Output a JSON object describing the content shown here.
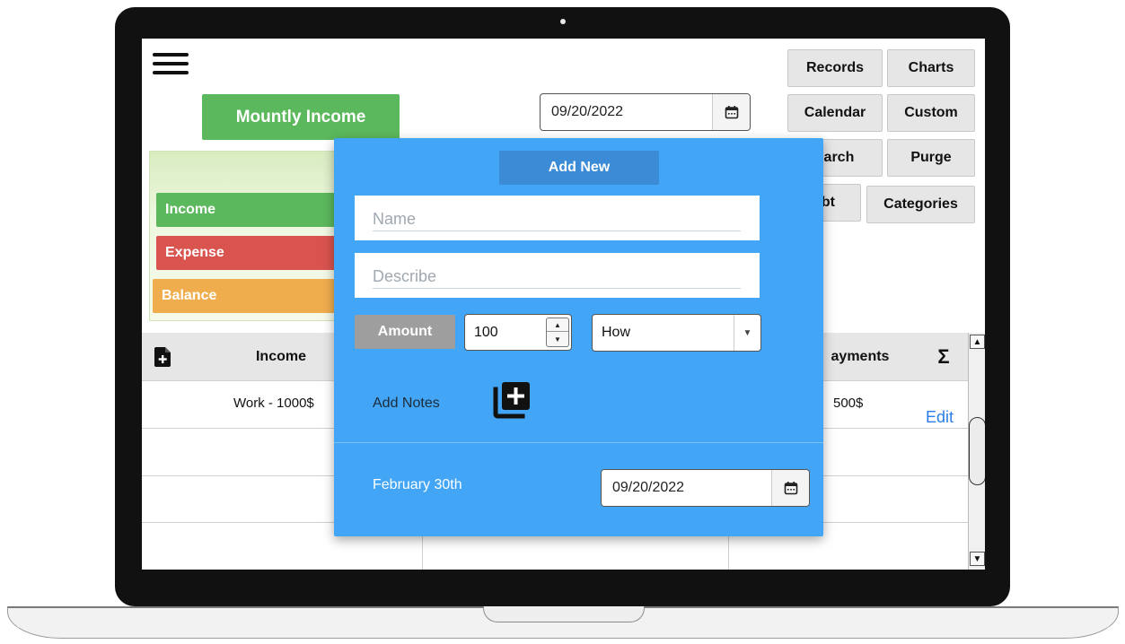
{
  "toolbar": {
    "monthly_income_label": "Mountly Income",
    "date_value": "09/20/2022"
  },
  "nav": {
    "records": "Records",
    "charts": "Charts",
    "calendar": "Calendar",
    "custom": "Custom",
    "search": "earch",
    "purge": "Purge",
    "debt": "ebt",
    "categories": "Categories"
  },
  "summary": {
    "income": "Income",
    "expense": "Expense",
    "balance": "Balance",
    "colors": {
      "income": "#5cb85c",
      "expense": "#d9534f",
      "balance": "#f0ad4e"
    }
  },
  "table": {
    "headers": {
      "income": "Income",
      "payments": "ayments",
      "sum_symbol": "Σ"
    },
    "rows": [
      {
        "income": "Work - 1000$",
        "payments": "500$",
        "action": "Edit"
      }
    ]
  },
  "modal": {
    "title": "Add New",
    "name_placeholder": "Name",
    "describe_placeholder": "Describe",
    "amount_label": "Amount",
    "amount_value": "100",
    "how_value": "How",
    "add_notes_label": "Add Notes",
    "date_label": "February 30th",
    "date_value": "09/20/2022",
    "accent_color": "#42a5f5"
  }
}
